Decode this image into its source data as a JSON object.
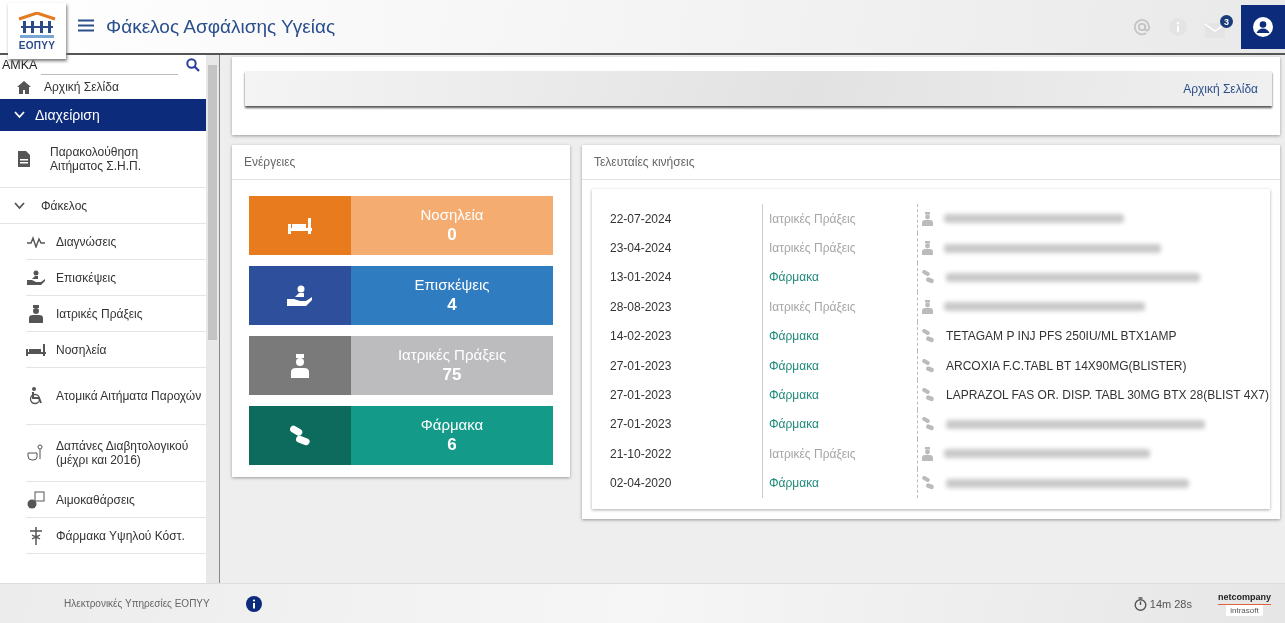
{
  "header": {
    "logo_text": "ΕΟΠΥΥ",
    "title": "Φάκελος Ασφάλισης Υγείας",
    "mail_count": "3"
  },
  "sidebar": {
    "search_label": "AMKA",
    "items": [
      {
        "kind": "link",
        "label": "Αρχική Σελίδα"
      },
      {
        "kind": "group",
        "label": "Διαχείριση",
        "expanded": true,
        "selected": true
      },
      {
        "kind": "link",
        "label": "Παρακολούθηση Αιτήματος Σ.Η.Π."
      },
      {
        "kind": "group",
        "label": "Φάκελος",
        "expanded": true,
        "selected": false,
        "children": [
          {
            "label": "Διαγνώσεις"
          },
          {
            "label": "Επισκέψεις"
          },
          {
            "label": "Ιατρικές Πράξεις"
          },
          {
            "label": "Νοσηλεία"
          },
          {
            "label": "Ατομικά Αιτήματα Παροχών"
          },
          {
            "label": "Δαπάνες Διαβητολογικού (μέχρι και 2016)"
          },
          {
            "label": "Αιμοκαθάρσεις"
          },
          {
            "label": "Φάρμακα Υψηλού Κόστ."
          }
        ]
      }
    ]
  },
  "breadcrumb": "Αρχική Σελίδα",
  "actions": {
    "title": "Ενέργειες",
    "tiles": [
      {
        "kind": "bed",
        "label": "Νοσηλεία",
        "count": "0",
        "color": "#e87b1e"
      },
      {
        "kind": "visit",
        "label": "Επισκέψεις",
        "count": "4",
        "color": "#2e4f9b"
      },
      {
        "kind": "doctor",
        "label": "Ιατρικές Πράξεις",
        "count": "75",
        "color": "#7a7a7a"
      },
      {
        "kind": "pills",
        "label": "Φάρμακα",
        "count": "6",
        "color": "#0c6b5c"
      }
    ]
  },
  "recent": {
    "title": "Τελευταίες κινήσεις",
    "rows": [
      {
        "date": "22-07-2024",
        "kind": "procedure",
        "category": "Ιατρικές Πράξεις",
        "redacted": true
      },
      {
        "date": "23-04-2024",
        "kind": "procedure",
        "category": "Ιατρικές Πράξεις",
        "redacted": true
      },
      {
        "date": "13-01-2024",
        "kind": "drug",
        "category": "Φάρμακα",
        "redacted": true
      },
      {
        "date": "28-08-2023",
        "kind": "procedure",
        "category": "Ιατρικές Πράξεις",
        "redacted": true
      },
      {
        "date": "14-02-2023",
        "kind": "drug",
        "category": "Φάρμακα",
        "redacted": false,
        "description": "TETAGAM P INJ PFS 250IU/ML BTX1AMP"
      },
      {
        "date": "27-01-2023",
        "kind": "drug",
        "category": "Φάρμακα",
        "redacted": false,
        "description": "ARCOXIA F.C.TABL BT 14X90MG(BLISTER)"
      },
      {
        "date": "27-01-2023",
        "kind": "drug",
        "category": "Φάρμακα",
        "redacted": false,
        "description": "LAPRAZOL FAS OR. DISP. TABL 30MG BTX 28(BLIST 4X7)"
      },
      {
        "date": "27-01-2023",
        "kind": "drug",
        "category": "Φάρμακα",
        "redacted": true
      },
      {
        "date": "21-10-2022",
        "kind": "procedure",
        "category": "Ιατρικές Πράξεις",
        "redacted": true
      },
      {
        "date": "02-04-2020",
        "kind": "drug",
        "category": "Φάρμακα",
        "redacted": true
      }
    ]
  },
  "footer": {
    "text": "Ηλεκτρονικές Υπηρεσίες ΕΟΠΥΥ",
    "timer": "14m 28s",
    "brand": "netcompany",
    "brand_sub": "intrasoft"
  }
}
